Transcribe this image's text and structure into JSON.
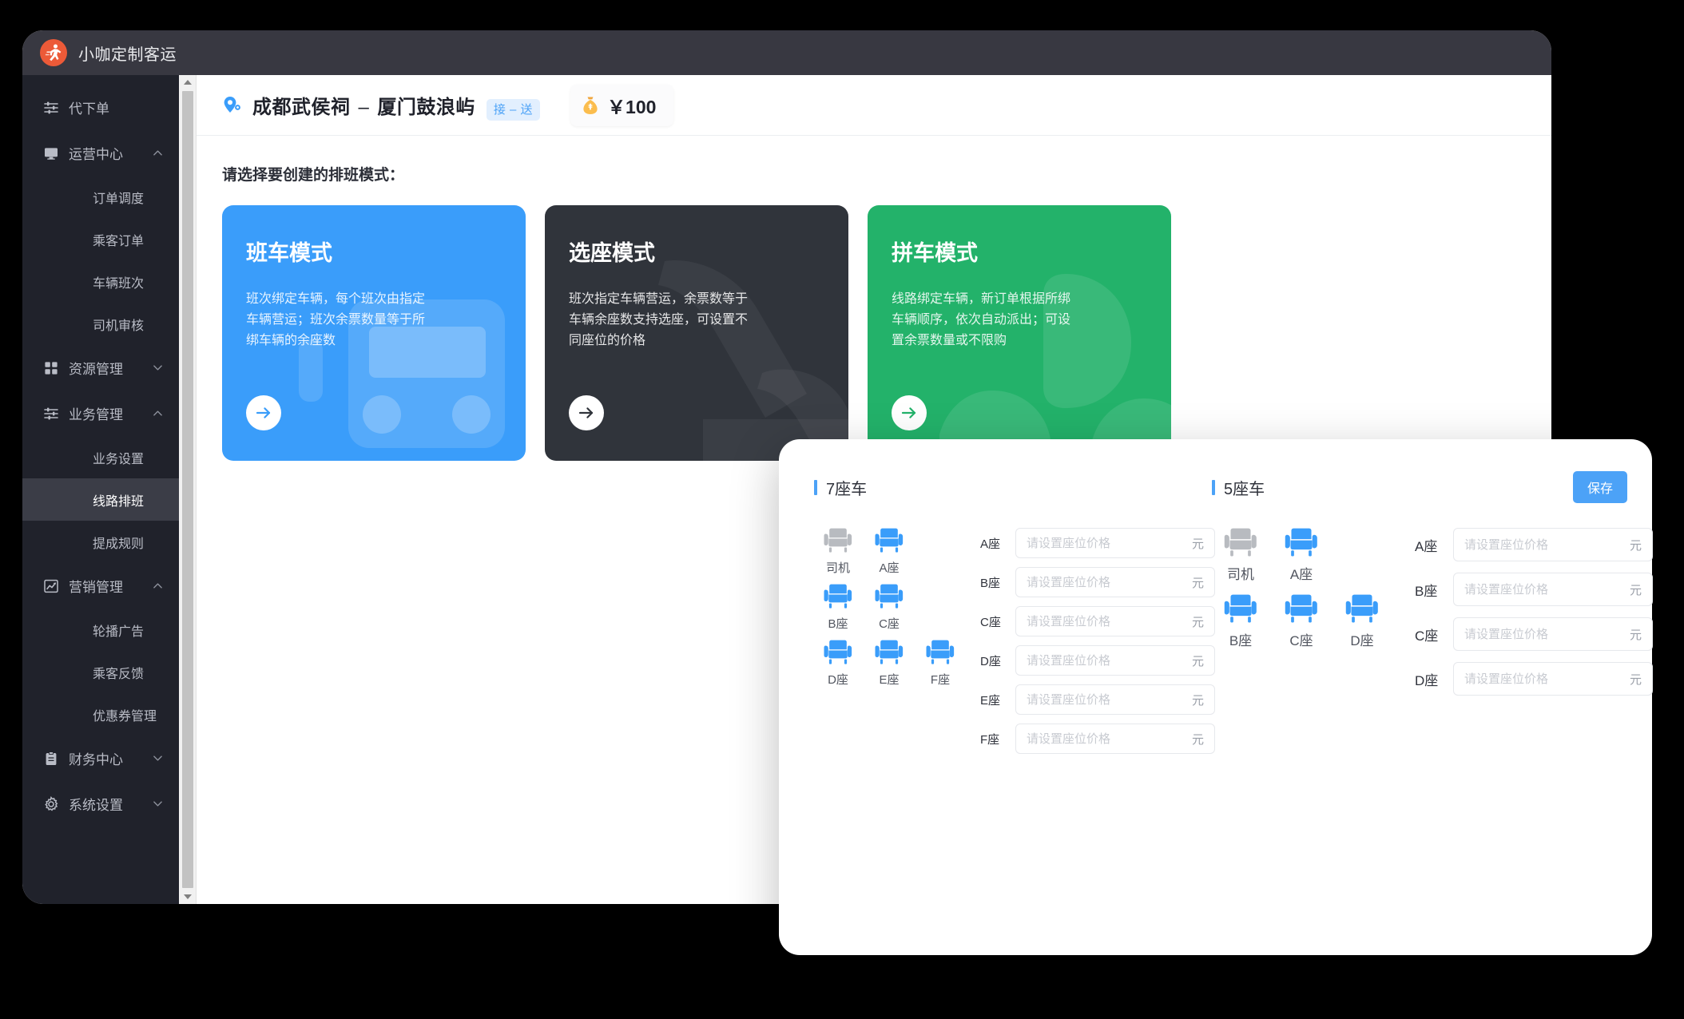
{
  "app": {
    "title": "小咖定制客运",
    "logo_icon": "runner-logo-icon"
  },
  "sidebar": {
    "items": [
      {
        "label": "代下单",
        "icon": "sliders-icon",
        "type": "group",
        "chevron": "",
        "level": 0
      },
      {
        "label": "运营中心",
        "icon": "monitor-icon",
        "type": "group",
        "chevron": "up",
        "level": 0
      },
      {
        "label": "订单调度",
        "icon": "",
        "type": "sub",
        "chevron": "",
        "level": 1
      },
      {
        "label": "乘客订单",
        "icon": "",
        "type": "sub",
        "chevron": "",
        "level": 1
      },
      {
        "label": "车辆班次",
        "icon": "",
        "type": "sub",
        "chevron": "",
        "level": 1
      },
      {
        "label": "司机审核",
        "icon": "",
        "type": "sub",
        "chevron": "",
        "level": 1
      },
      {
        "label": "资源管理",
        "icon": "grid-icon",
        "type": "group",
        "chevron": "down",
        "level": 0
      },
      {
        "label": "业务管理",
        "icon": "sliders-icon",
        "type": "group",
        "chevron": "up",
        "level": 0
      },
      {
        "label": "业务设置",
        "icon": "",
        "type": "sub",
        "chevron": "",
        "level": 1
      },
      {
        "label": "线路排班",
        "icon": "",
        "type": "sub",
        "chevron": "",
        "level": 1,
        "active": true
      },
      {
        "label": "提成规则",
        "icon": "",
        "type": "sub",
        "chevron": "",
        "level": 1
      },
      {
        "label": "营销管理",
        "icon": "chart-icon",
        "type": "group",
        "chevron": "up",
        "level": 0
      },
      {
        "label": "轮播广告",
        "icon": "",
        "type": "sub",
        "chevron": "",
        "level": 1
      },
      {
        "label": "乘客反馈",
        "icon": "",
        "type": "sub",
        "chevron": "",
        "level": 1
      },
      {
        "label": "优惠券管理",
        "icon": "",
        "type": "sub",
        "chevron": "",
        "level": 1
      },
      {
        "label": "财务中心",
        "icon": "clipboard-icon",
        "type": "group",
        "chevron": "down",
        "level": 0
      },
      {
        "label": "系统设置",
        "icon": "gear-icon",
        "type": "group",
        "chevron": "down",
        "level": 0
      }
    ]
  },
  "route_bar": {
    "pin_icon": "location-pin-icon",
    "origin": "成都武侯祠",
    "dash": "–",
    "destination": "厦门鼓浪屿",
    "tag": "接 – 送",
    "money_icon": "money-bag-icon",
    "price": "￥100"
  },
  "main": {
    "prompt": "请选择要创建的排班模式：",
    "cards": [
      {
        "title": "班车模式",
        "desc": "班次绑定车辆，每个班次由指定\n车辆营运；班次余票数量等于所\n绑车辆的余座数",
        "color": "#3a9dfa",
        "watermark": "bus-watermark-icon",
        "arrow_icon": "arrow-right-icon"
      },
      {
        "title": "选座模式",
        "desc": "班次指定车辆营运，余票数等于\n车辆余座数支持选座，可设置不\n同座位的价格",
        "color": "#30343b",
        "watermark": "seat-watermark-icon",
        "arrow_icon": "arrow-right-icon"
      },
      {
        "title": "拼车模式",
        "desc": "线路绑定车辆，新订单根据所绑\n车辆顺序，依次自动派出；可设\n置余票数量或不限购",
        "color": "#23b26a",
        "watermark": "leaf-watermark-icon",
        "arrow_icon": "arrow-right-icon"
      }
    ]
  },
  "seat_panel": {
    "save_label": "保存",
    "price_placeholder": "请设置座位价格",
    "unit": "元",
    "sections": [
      {
        "title": "7座车",
        "layout": [
          [
            {
              "label": "司机",
              "state": "driver"
            },
            {
              "label": "A座",
              "state": "seat"
            }
          ],
          [
            {
              "label": "B座",
              "state": "seat"
            },
            {
              "label": "C座",
              "state": "seat"
            }
          ],
          [
            {
              "label": "D座",
              "state": "seat"
            },
            {
              "label": "E座",
              "state": "seat"
            },
            {
              "label": "F座",
              "state": "seat"
            }
          ]
        ],
        "prices": [
          {
            "label": "A座",
            "value": ""
          },
          {
            "label": "B座",
            "value": ""
          },
          {
            "label": "C座",
            "value": ""
          },
          {
            "label": "D座",
            "value": ""
          },
          {
            "label": "E座",
            "value": ""
          },
          {
            "label": "F座",
            "value": ""
          }
        ]
      },
      {
        "title": "5座车",
        "layout": [
          [
            {
              "label": "司机",
              "state": "driver"
            },
            {
              "label": "A座",
              "state": "seat"
            }
          ],
          [
            {
              "label": "B座",
              "state": "seat"
            },
            {
              "label": "C座",
              "state": "seat"
            },
            {
              "label": "D座",
              "state": "seat"
            }
          ]
        ],
        "prices": [
          {
            "label": "A座",
            "value": ""
          },
          {
            "label": "B座",
            "value": ""
          },
          {
            "label": "C座",
            "value": ""
          },
          {
            "label": "D座",
            "value": ""
          }
        ]
      }
    ]
  },
  "colors": {
    "accent_blue": "#4ca2f7",
    "card_blue": "#3a9dfa",
    "card_dark": "#30343b",
    "card_green": "#23b26a",
    "sidebar_bg": "#20222b",
    "titlebar_bg": "#383841",
    "logo_orange": "#ec5a38",
    "seat_blue": "#3a9dfa",
    "seat_gray": "#b8bbc0"
  }
}
